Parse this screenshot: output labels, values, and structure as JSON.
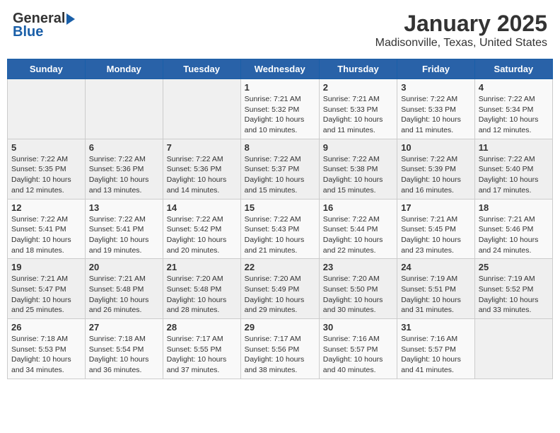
{
  "header": {
    "logo_general": "General",
    "logo_blue": "Blue",
    "title": "January 2025",
    "subtitle": "Madisonville, Texas, United States"
  },
  "days_of_week": [
    "Sunday",
    "Monday",
    "Tuesday",
    "Wednesday",
    "Thursday",
    "Friday",
    "Saturday"
  ],
  "weeks": [
    {
      "days": [
        {
          "num": "",
          "detail": ""
        },
        {
          "num": "",
          "detail": ""
        },
        {
          "num": "",
          "detail": ""
        },
        {
          "num": "1",
          "detail": "Sunrise: 7:21 AM\nSunset: 5:32 PM\nDaylight: 10 hours\nand 10 minutes."
        },
        {
          "num": "2",
          "detail": "Sunrise: 7:21 AM\nSunset: 5:33 PM\nDaylight: 10 hours\nand 11 minutes."
        },
        {
          "num": "3",
          "detail": "Sunrise: 7:22 AM\nSunset: 5:33 PM\nDaylight: 10 hours\nand 11 minutes."
        },
        {
          "num": "4",
          "detail": "Sunrise: 7:22 AM\nSunset: 5:34 PM\nDaylight: 10 hours\nand 12 minutes."
        }
      ]
    },
    {
      "days": [
        {
          "num": "5",
          "detail": "Sunrise: 7:22 AM\nSunset: 5:35 PM\nDaylight: 10 hours\nand 12 minutes."
        },
        {
          "num": "6",
          "detail": "Sunrise: 7:22 AM\nSunset: 5:36 PM\nDaylight: 10 hours\nand 13 minutes."
        },
        {
          "num": "7",
          "detail": "Sunrise: 7:22 AM\nSunset: 5:36 PM\nDaylight: 10 hours\nand 14 minutes."
        },
        {
          "num": "8",
          "detail": "Sunrise: 7:22 AM\nSunset: 5:37 PM\nDaylight: 10 hours\nand 15 minutes."
        },
        {
          "num": "9",
          "detail": "Sunrise: 7:22 AM\nSunset: 5:38 PM\nDaylight: 10 hours\nand 15 minutes."
        },
        {
          "num": "10",
          "detail": "Sunrise: 7:22 AM\nSunset: 5:39 PM\nDaylight: 10 hours\nand 16 minutes."
        },
        {
          "num": "11",
          "detail": "Sunrise: 7:22 AM\nSunset: 5:40 PM\nDaylight: 10 hours\nand 17 minutes."
        }
      ]
    },
    {
      "days": [
        {
          "num": "12",
          "detail": "Sunrise: 7:22 AM\nSunset: 5:41 PM\nDaylight: 10 hours\nand 18 minutes."
        },
        {
          "num": "13",
          "detail": "Sunrise: 7:22 AM\nSunset: 5:41 PM\nDaylight: 10 hours\nand 19 minutes."
        },
        {
          "num": "14",
          "detail": "Sunrise: 7:22 AM\nSunset: 5:42 PM\nDaylight: 10 hours\nand 20 minutes."
        },
        {
          "num": "15",
          "detail": "Sunrise: 7:22 AM\nSunset: 5:43 PM\nDaylight: 10 hours\nand 21 minutes."
        },
        {
          "num": "16",
          "detail": "Sunrise: 7:22 AM\nSunset: 5:44 PM\nDaylight: 10 hours\nand 22 minutes."
        },
        {
          "num": "17",
          "detail": "Sunrise: 7:21 AM\nSunset: 5:45 PM\nDaylight: 10 hours\nand 23 minutes."
        },
        {
          "num": "18",
          "detail": "Sunrise: 7:21 AM\nSunset: 5:46 PM\nDaylight: 10 hours\nand 24 minutes."
        }
      ]
    },
    {
      "days": [
        {
          "num": "19",
          "detail": "Sunrise: 7:21 AM\nSunset: 5:47 PM\nDaylight: 10 hours\nand 25 minutes."
        },
        {
          "num": "20",
          "detail": "Sunrise: 7:21 AM\nSunset: 5:48 PM\nDaylight: 10 hours\nand 26 minutes."
        },
        {
          "num": "21",
          "detail": "Sunrise: 7:20 AM\nSunset: 5:48 PM\nDaylight: 10 hours\nand 28 minutes."
        },
        {
          "num": "22",
          "detail": "Sunrise: 7:20 AM\nSunset: 5:49 PM\nDaylight: 10 hours\nand 29 minutes."
        },
        {
          "num": "23",
          "detail": "Sunrise: 7:20 AM\nSunset: 5:50 PM\nDaylight: 10 hours\nand 30 minutes."
        },
        {
          "num": "24",
          "detail": "Sunrise: 7:19 AM\nSunset: 5:51 PM\nDaylight: 10 hours\nand 31 minutes."
        },
        {
          "num": "25",
          "detail": "Sunrise: 7:19 AM\nSunset: 5:52 PM\nDaylight: 10 hours\nand 33 minutes."
        }
      ]
    },
    {
      "days": [
        {
          "num": "26",
          "detail": "Sunrise: 7:18 AM\nSunset: 5:53 PM\nDaylight: 10 hours\nand 34 minutes."
        },
        {
          "num": "27",
          "detail": "Sunrise: 7:18 AM\nSunset: 5:54 PM\nDaylight: 10 hours\nand 36 minutes."
        },
        {
          "num": "28",
          "detail": "Sunrise: 7:17 AM\nSunset: 5:55 PM\nDaylight: 10 hours\nand 37 minutes."
        },
        {
          "num": "29",
          "detail": "Sunrise: 7:17 AM\nSunset: 5:56 PM\nDaylight: 10 hours\nand 38 minutes."
        },
        {
          "num": "30",
          "detail": "Sunrise: 7:16 AM\nSunset: 5:57 PM\nDaylight: 10 hours\nand 40 minutes."
        },
        {
          "num": "31",
          "detail": "Sunrise: 7:16 AM\nSunset: 5:57 PM\nDaylight: 10 hours\nand 41 minutes."
        },
        {
          "num": "",
          "detail": ""
        }
      ]
    }
  ]
}
